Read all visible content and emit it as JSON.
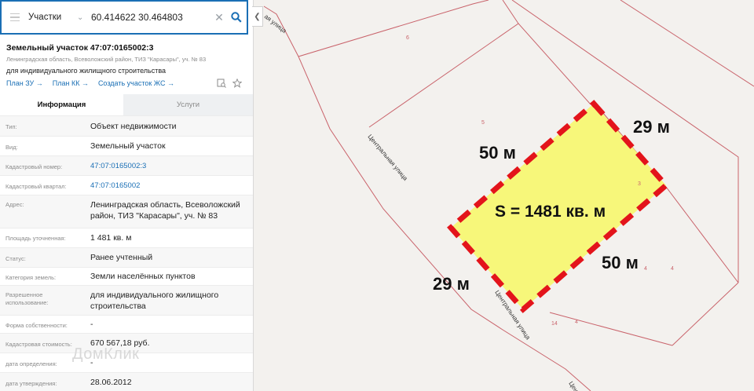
{
  "search": {
    "type_label": "Участки",
    "coords": "60.414622 30.464803"
  },
  "parcel": {
    "title": "Земельный участок 47:07:0165002:3",
    "address_sub": "Ленинградская область, Всеволожский район, ТИЗ \"Карасары\", уч. № 83",
    "purpose": "для индивидуального жилищного строительства"
  },
  "links": {
    "plan_zu": "План ЗУ →",
    "plan_kk": "План КК →",
    "create": "Создать участок ЖС →"
  },
  "tabs": {
    "info": "Информация",
    "services": "Услуги"
  },
  "rows": [
    {
      "label": "Тип:",
      "value": "Объект недвижимости"
    },
    {
      "label": "Вид:",
      "value": "Земельный участок"
    },
    {
      "label": "Кадастровый номер:",
      "value": "47:07:0165002:3"
    },
    {
      "label": "Кадастровый квартал:",
      "value": "47:07:0165002"
    },
    {
      "label": "Адрес:",
      "value": "Ленинградская область, Всеволожский район, ТИЗ \"Карасары\", уч. № 83"
    },
    {
      "label": "Площадь уточненная:",
      "value": "1 481 кв. м"
    },
    {
      "label": "Статус:",
      "value": "Ранее учтенный"
    },
    {
      "label": "Категория земель:",
      "value": "Земли населённых пунктов"
    },
    {
      "label": "Разрешенное использование:",
      "value": "для индивидуального жилищного строительства"
    },
    {
      "label": "Форма собственности:",
      "value": "-"
    },
    {
      "label": "Кадастровая стоимость:",
      "value": "670 567,18 руб."
    },
    {
      "label": "дата определения:",
      "value": "-"
    },
    {
      "label": "дата утверждения:",
      "value": "28.06.2012"
    }
  ],
  "watermark": "ДомКлик",
  "map": {
    "street_top": "ая улица",
    "street_mid": "Центральная улица",
    "street_low": "Центральная улица",
    "street_bottom": "Цен",
    "plot_numbers": {
      "n6": "6",
      "n5": "5",
      "n3": "3",
      "n4a": "4",
      "n4b": "4",
      "n14": "14",
      "n4c": "4"
    },
    "dim_top_left": "50 м",
    "dim_top_right": "29 м",
    "dim_bottom_right": "50 м",
    "dim_bottom_left": "29 м",
    "area_label": "S = 1481 кв. м",
    "highlight_fill": "#f7f77a",
    "border_color": "#e3141b",
    "lines_color": "#c9636b"
  }
}
